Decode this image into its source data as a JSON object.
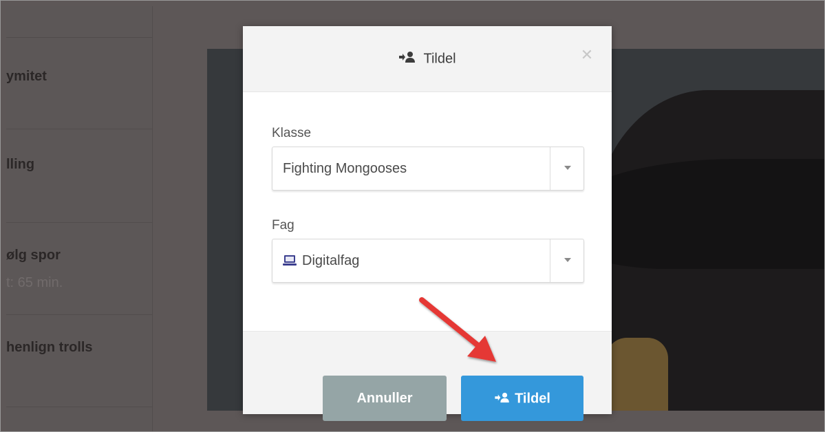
{
  "background": {
    "left_items": [
      {
        "label": "ymitet"
      },
      {
        "label": "lling"
      },
      {
        "label": "ølg spor",
        "sub": "t: 65 min."
      },
      {
        "label": "henlign trolls"
      }
    ]
  },
  "modal": {
    "title": "Tildel",
    "title_icon": "assign-user-icon",
    "close_icon": "close-icon",
    "fields": {
      "klasse": {
        "label": "Klasse",
        "value": "Fighting Mongooses"
      },
      "fag": {
        "label": "Fag",
        "value": "Digitalfag",
        "value_icon": "laptop-icon"
      }
    },
    "buttons": {
      "cancel": "Annuller",
      "submit": "Tildel"
    }
  },
  "colors": {
    "primary": "#3498db",
    "cancel": "#95a5a6",
    "arrow": "#e53935"
  }
}
